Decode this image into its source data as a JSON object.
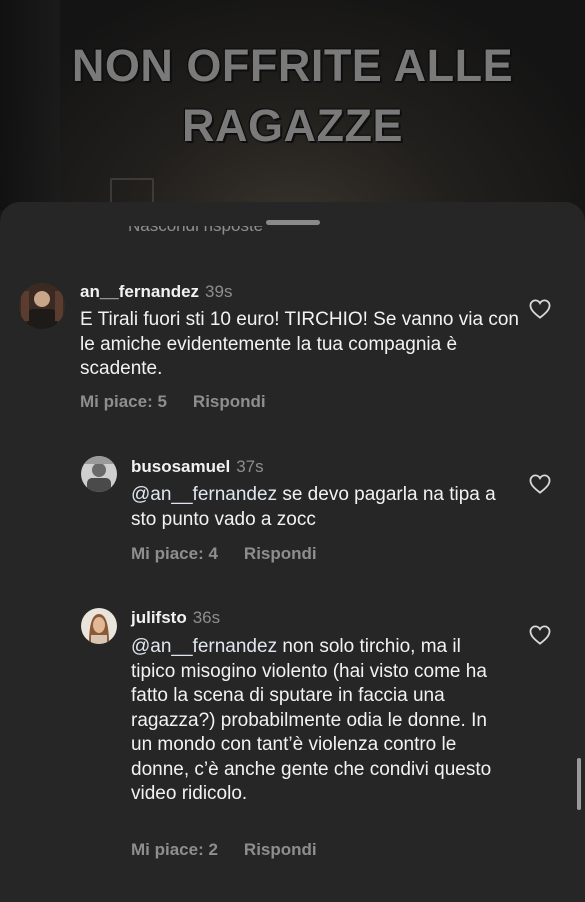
{
  "video": {
    "overlay_title_line1": "NON OFFRITE ALLE",
    "overlay_title_line2": "RAGAZZE"
  },
  "sheet": {
    "clipped_text": "Nascondi risposte"
  },
  "comments": [
    {
      "username": "an__fernandez",
      "time": "39s",
      "text": "E Tirali fuori sti 10 euro! TIRCHIO! Se vanno via con le amiche evidentemente la tua compagnia è scadente.",
      "likes_label": "Mi piace: 5",
      "reply_label": "Rispondi"
    },
    {
      "username": "busosamuel",
      "time": "37s",
      "mention": "@an__fernandez",
      "text": " se devo pagarla na tipa a sto punto vado a zocc",
      "likes_label": "Mi piace: 4",
      "reply_label": "Rispondi"
    },
    {
      "username": "julifsto",
      "time": "36s",
      "mention": "@an__fernandez",
      "text": " non solo tirchio, ma il tipico misogino violento (hai visto come ha fatto la scena di sputare in faccia una ragazza?) probabilmente odia le donne. In un mondo con tant’è violenza contro le donne, c’è anche gente che condivi questo video ridicolo.",
      "likes_label": "Mi piace: 2",
      "reply_label": "Rispondi"
    }
  ],
  "colors": {
    "sheet_bg": "#262626",
    "text_primary": "#f2f2f2",
    "text_secondary": "#8e8e8e"
  },
  "icons": [
    "heart-outline-icon"
  ]
}
